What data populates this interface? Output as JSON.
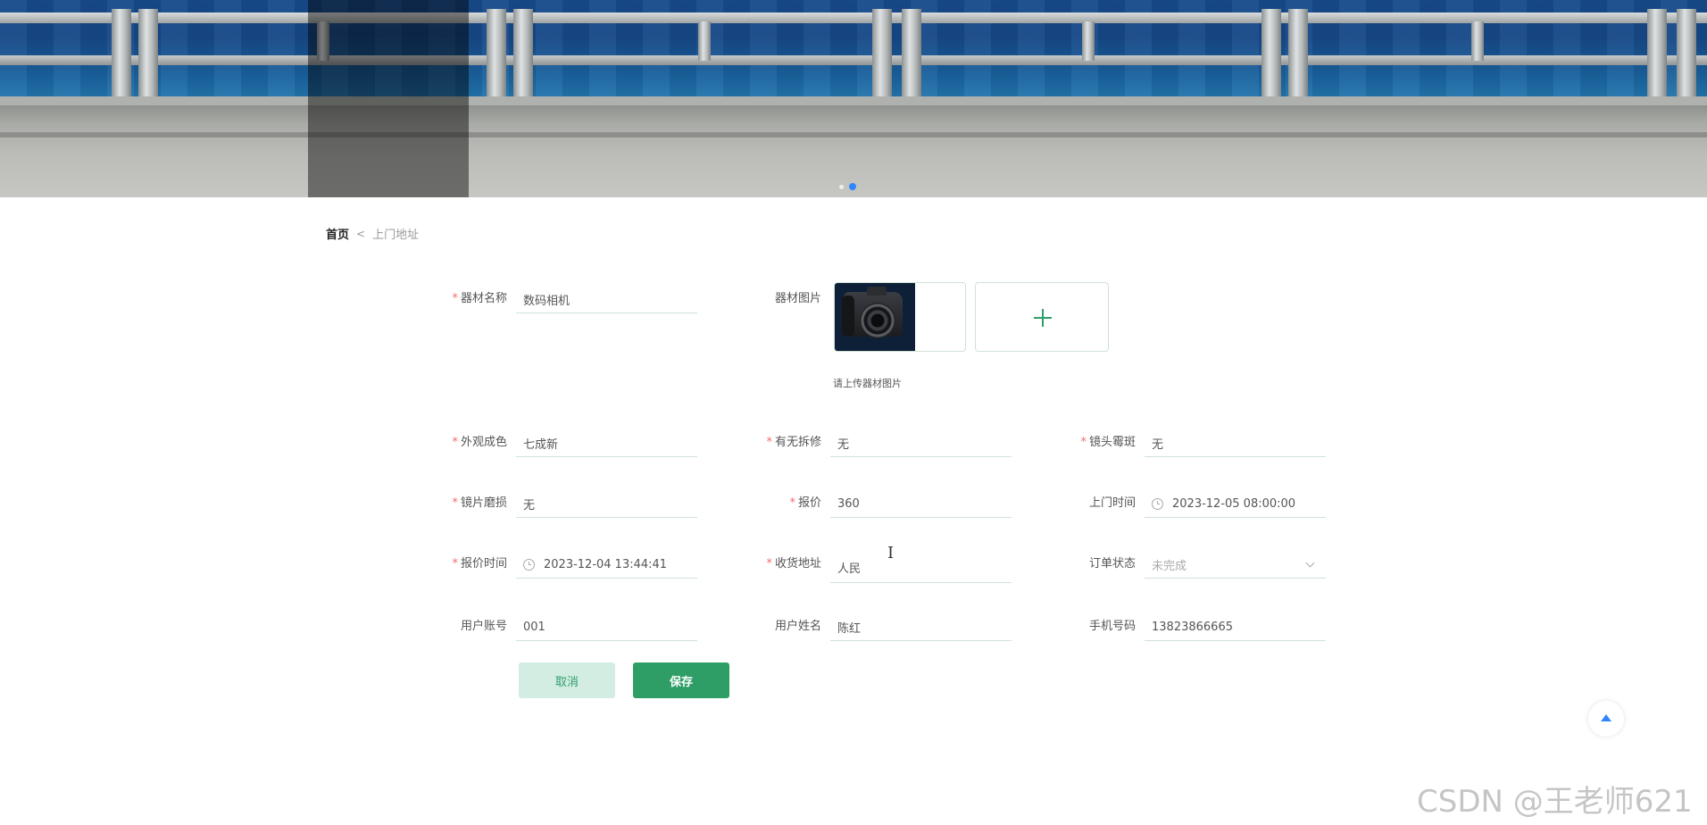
{
  "breadcrumb": {
    "home": "首页",
    "separator": "<",
    "current": "上门地址"
  },
  "banner": {
    "carousel_dot_count": 2,
    "active_index": 1,
    "accent_color": "#2f86ff"
  },
  "form": {
    "equipment_name": {
      "label": "器材名称",
      "required": true,
      "value": "数码相机"
    },
    "equipment_image": {
      "label": "器材图片",
      "tip": "请上传器材图片"
    },
    "appearance": {
      "label": "外观成色",
      "required": true,
      "value": "七成新"
    },
    "repair_history": {
      "label": "有无拆修",
      "required": true,
      "value": "无"
    },
    "lens_mold": {
      "label": "镜头霉斑",
      "required": true,
      "value": "无"
    },
    "lens_wear": {
      "label": "镜片磨损",
      "required": true,
      "value": "无"
    },
    "price": {
      "label": "报价",
      "required": true,
      "value": "360"
    },
    "visit_time": {
      "label": "上门时间",
      "required": false,
      "value": "2023-12-05 08:00:00"
    },
    "quote_time": {
      "label": "报价时间",
      "required": true,
      "value": "2023-12-04 13:44:41"
    },
    "delivery_address": {
      "label": "收货地址",
      "required": true,
      "value": "人民"
    },
    "order_status": {
      "label": "订单状态",
      "required": false,
      "placeholder": "未完成"
    },
    "user_account": {
      "label": "用户账号",
      "required": false,
      "value": "001"
    },
    "user_name": {
      "label": "用户姓名",
      "required": false,
      "value": "陈红"
    },
    "phone": {
      "label": "手机号码",
      "required": false,
      "value": "13823866665"
    }
  },
  "buttons": {
    "cancel": "取消",
    "save": "保存"
  },
  "colors": {
    "primary": "#2e9e66",
    "primary_light": "#d4ede3",
    "required": "#f56c6c",
    "input_border": "#cfe2d8"
  },
  "watermark": "CSDN @王老师621"
}
